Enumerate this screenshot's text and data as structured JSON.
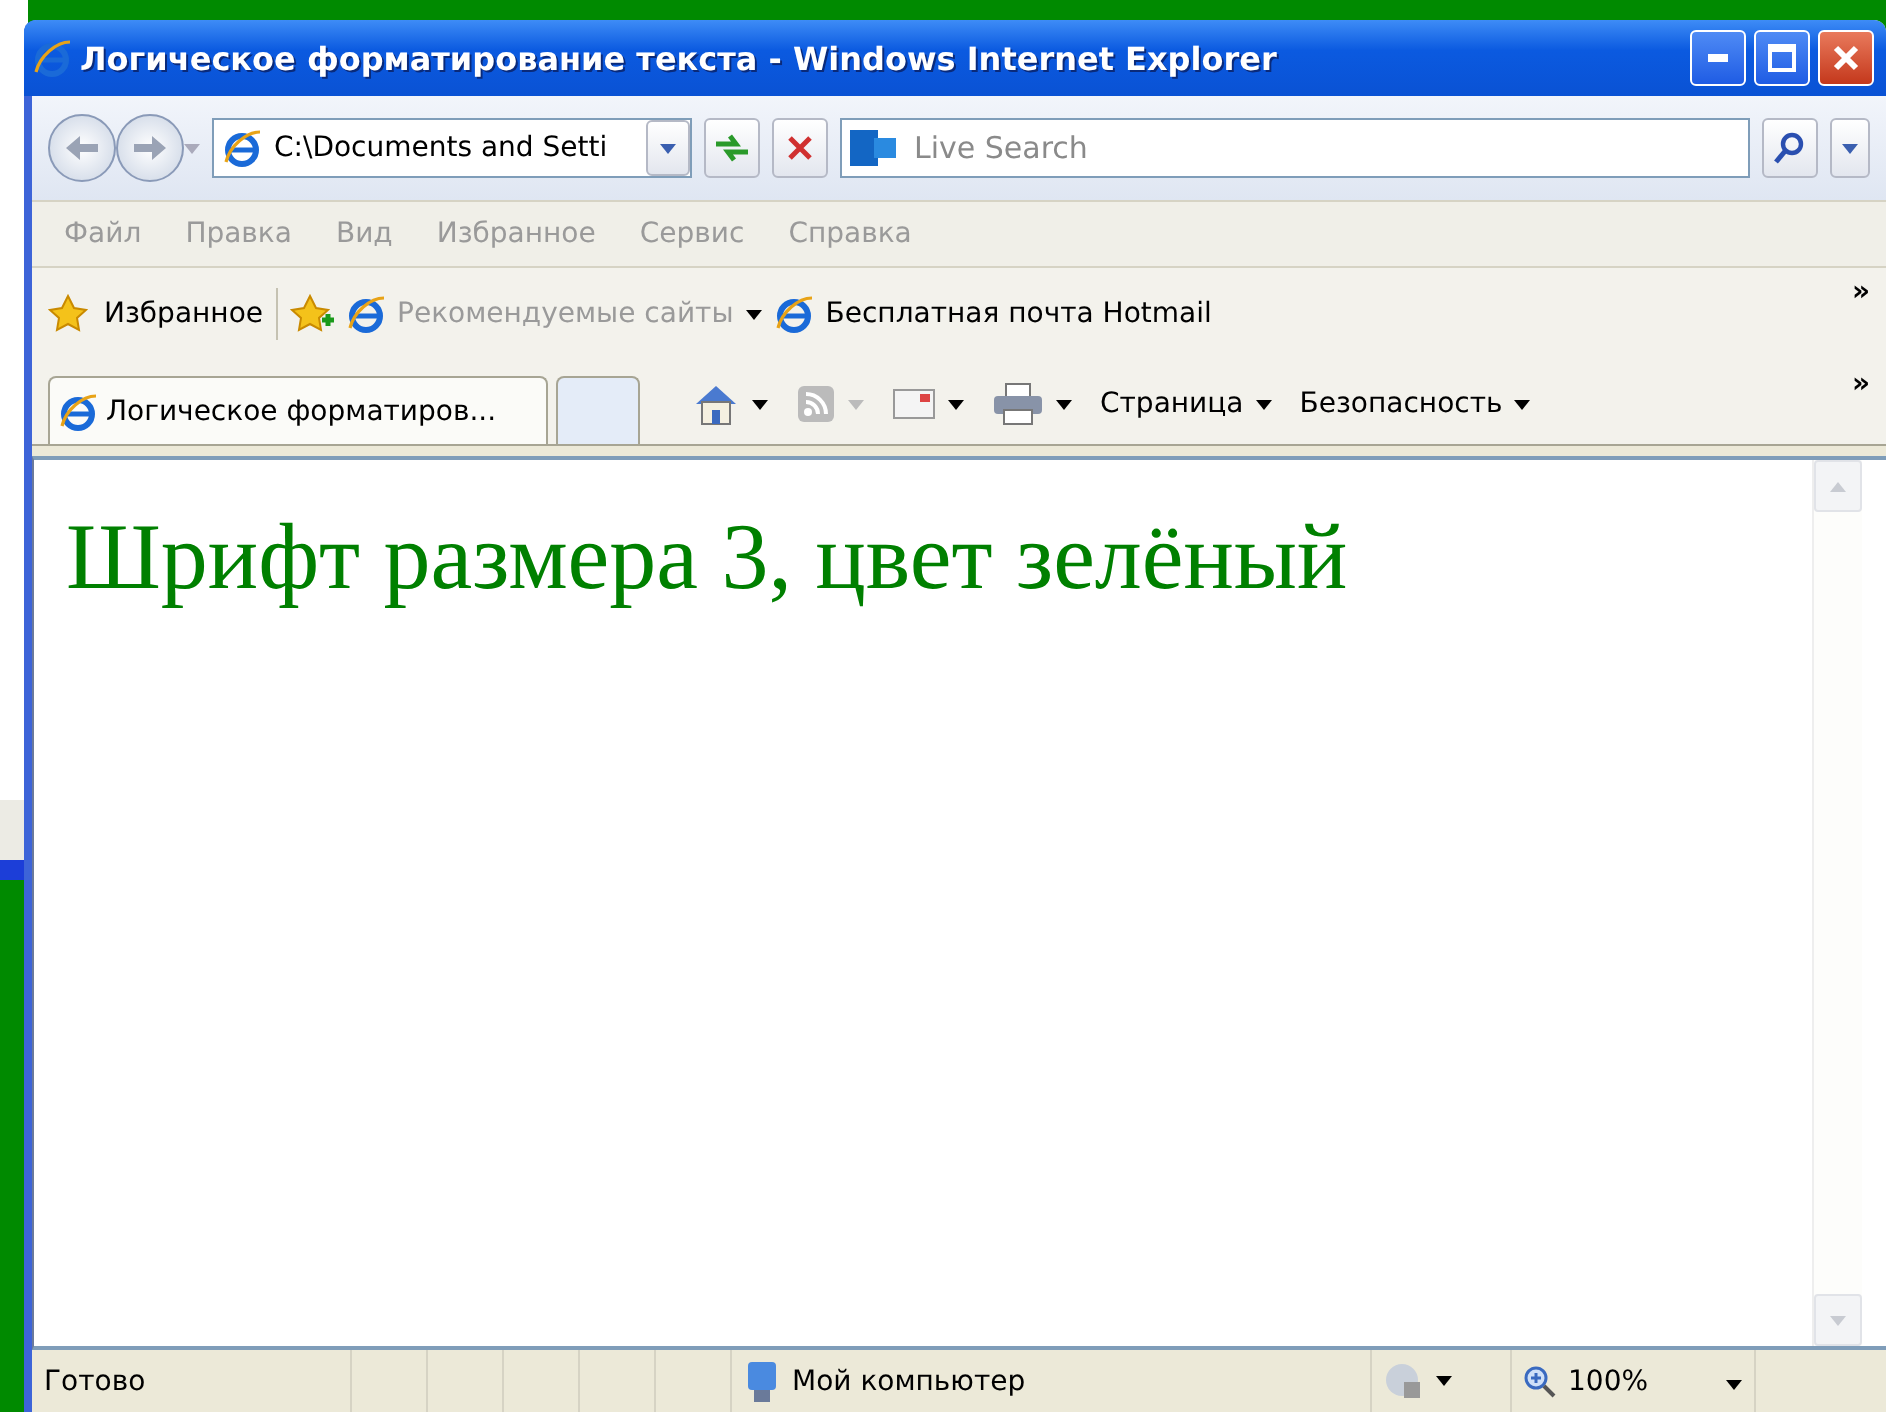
{
  "window": {
    "title": "Логическое форматирование текста - Windows Internet Explorer"
  },
  "address_bar": {
    "value": "C:\\Documents and Setti"
  },
  "search": {
    "placeholder": "Live Search"
  },
  "menu": [
    {
      "label": "Файл",
      "disabled": true
    },
    {
      "label": "Правка",
      "disabled": true
    },
    {
      "label": "Вид",
      "disabled": true
    },
    {
      "label": "Избранное",
      "disabled": true
    },
    {
      "label": "Сервис",
      "disabled": true
    },
    {
      "label": "Справка",
      "disabled": true
    }
  ],
  "favorites_bar": {
    "favorites_label": "Избранное",
    "links": [
      {
        "label": "Рекомендуемые сайты",
        "disabled": true,
        "dropdown": true
      },
      {
        "label": "Бесплатная почта Hotmail",
        "disabled": false,
        "dropdown": false
      }
    ],
    "chevron": "»"
  },
  "tabs": [
    {
      "label": "Логическое форматиров...",
      "selected": true
    },
    {
      "selected": false
    }
  ],
  "command_bar": {
    "items": [
      {
        "kind": "home"
      },
      {
        "kind": "feeds"
      },
      {
        "kind": "mail"
      },
      {
        "kind": "print"
      },
      {
        "kind": "menu",
        "label": "Страница"
      },
      {
        "kind": "menu",
        "label": "Безопасность"
      }
    ],
    "chevron": "»"
  },
  "content": {
    "text": "Шрифт размера 3, цвет зелёный",
    "color": "#008000"
  },
  "status_bar": {
    "status": "Готово",
    "zone": "Мой компьютер",
    "zoom": "100%"
  }
}
